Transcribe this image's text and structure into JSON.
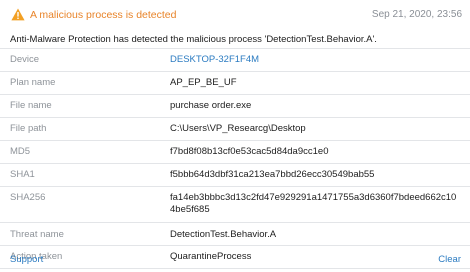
{
  "header": {
    "title": "A malicious process is detected",
    "timestamp": "Sep 21, 2020, 23:56",
    "icon": "warning-icon",
    "accent_color": "#e8842a"
  },
  "message": "Anti-Malware Protection has detected the malicious process 'DetectionTest.Behavior.A'.",
  "details": [
    {
      "label": "Device",
      "value": "DESKTOP-32F1F4M"
    },
    {
      "label": "Plan name",
      "value": "AP_EP_BE_UF"
    },
    {
      "label": "File name",
      "value": "purchase order.exe"
    },
    {
      "label": "File path",
      "value": "C:\\Users\\VP_Researcg\\Desktop"
    },
    {
      "label": "MD5",
      "value": "f7bd8f08b13cf0e53cac5d84da9cc1e0"
    },
    {
      "label": "SHA1",
      "value": "f5bbb64d3dbf31ca213ea7bbd26ecc30549bab55"
    },
    {
      "label": "SHA256",
      "value": "fa14eb3bbbc3d13c2fd47e929291a1471755a3d6360f7bdeed662c104be5f685"
    },
    {
      "label": "Threat name",
      "value": "DetectionTest.Behavior.A"
    },
    {
      "label": "Action taken",
      "value": "QuarantineProcess"
    }
  ],
  "footer": {
    "support_label": "Support",
    "clear_label": "Clear"
  }
}
